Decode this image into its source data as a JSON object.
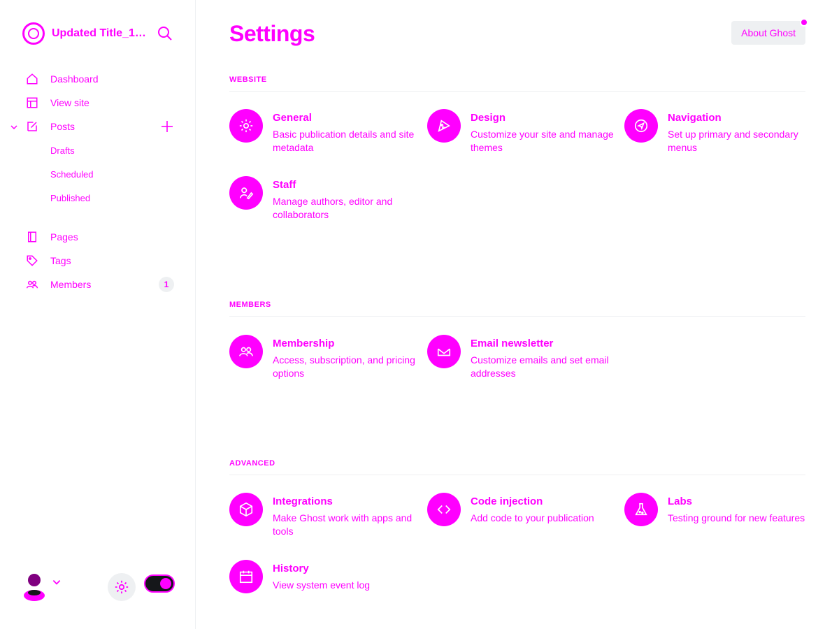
{
  "sidebar": {
    "site_title": "Updated Title_17...",
    "nav": {
      "dashboard": "Dashboard",
      "view_site": "View site",
      "posts": "Posts",
      "drafts": "Drafts",
      "scheduled": "Scheduled",
      "published": "Published",
      "pages": "Pages",
      "tags": "Tags",
      "members": "Members",
      "members_count": "1"
    }
  },
  "header": {
    "title": "Settings",
    "about_label": "About Ghost"
  },
  "sections": {
    "website": {
      "title": "WEBSITE",
      "general": {
        "title": "General",
        "desc": "Basic publication details and site metadata"
      },
      "design": {
        "title": "Design",
        "desc": "Customize your site and manage themes"
      },
      "navigation": {
        "title": "Navigation",
        "desc": "Set up primary and secondary menus"
      },
      "staff": {
        "title": "Staff",
        "desc": "Manage authors, editor and collaborators"
      }
    },
    "members": {
      "title": "MEMBERS",
      "membership": {
        "title": "Membership",
        "desc": "Access, subscription, and pricing options"
      },
      "email_newsletter": {
        "title": "Email newsletter",
        "desc": "Customize emails and set email addresses"
      }
    },
    "advanced": {
      "title": "ADVANCED",
      "integrations": {
        "title": "Integrations",
        "desc": "Make Ghost work with apps and tools"
      },
      "code_injection": {
        "title": "Code injection",
        "desc": "Add code to your publication"
      },
      "labs": {
        "title": "Labs",
        "desc": "Testing ground for new features"
      },
      "history": {
        "title": "History",
        "desc": "View system event log"
      }
    }
  },
  "colors": {
    "accent": "#ff00ff",
    "text_dark": "#15171a",
    "divider": "#eef0f2"
  }
}
